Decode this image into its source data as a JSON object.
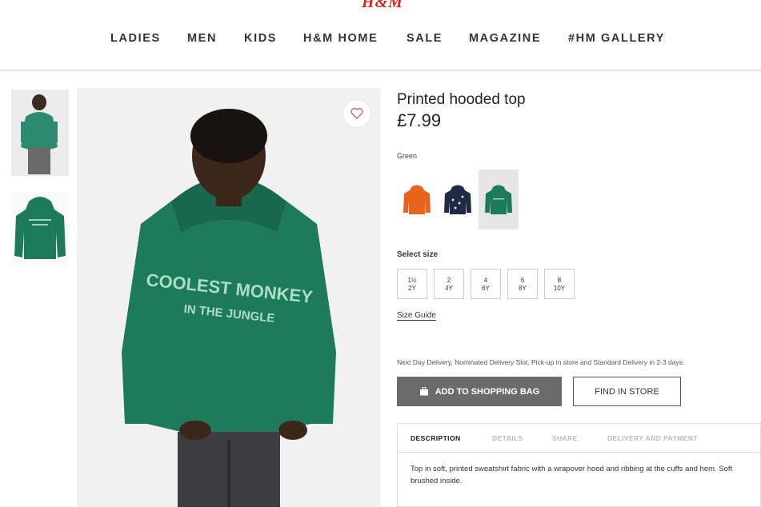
{
  "header": {
    "logo": "H&M",
    "nav": [
      "LADIES",
      "MEN",
      "KIDS",
      "H&M HOME",
      "SALE",
      "MAGAZINE",
      "#HM GALLERY"
    ]
  },
  "product": {
    "title": "Printed hooded top",
    "price": "£7.99",
    "color_label": "Green",
    "hoodie_print_line1": "COOLEST MONKEY",
    "hoodie_print_line2": "IN THE JUNGLE",
    "swatches": [
      {
        "name": "orange",
        "color": "#e8641e"
      },
      {
        "name": "navy",
        "color": "#1f2a44"
      },
      {
        "name": "green",
        "color": "#1d7a5a",
        "selected": true
      }
    ],
    "size_label": "Select size",
    "sizes": [
      {
        "top": "1½",
        "bottom": "2Y"
      },
      {
        "top": "2",
        "bottom": "4Y"
      },
      {
        "top": "4",
        "bottom": "6Y"
      },
      {
        "top": "6",
        "bottom": "8Y"
      },
      {
        "top": "8",
        "bottom": "10Y"
      }
    ],
    "size_guide": "Size Guide",
    "delivery": "Next Day Delivery, Nominated Delivery Slot, Pick-up in store and Standard Delivery in 2-3 days.",
    "add_to_bag": "ADD TO SHOPPING BAG",
    "find_in_store": "FIND IN STORE",
    "tabs": [
      "DESCRIPTION",
      "DETAILS",
      "SHARE",
      "DELIVERY AND PAYMENT"
    ],
    "description": "Top in soft, printed sweatshirt fabric with a wrapover hood and ribbing at the cuffs and hem. Soft brushed inside."
  },
  "colors": {
    "hoodie_green": "#1d7a5a",
    "brand_red": "#d9231d",
    "button_grey": "#6b6b6b"
  }
}
